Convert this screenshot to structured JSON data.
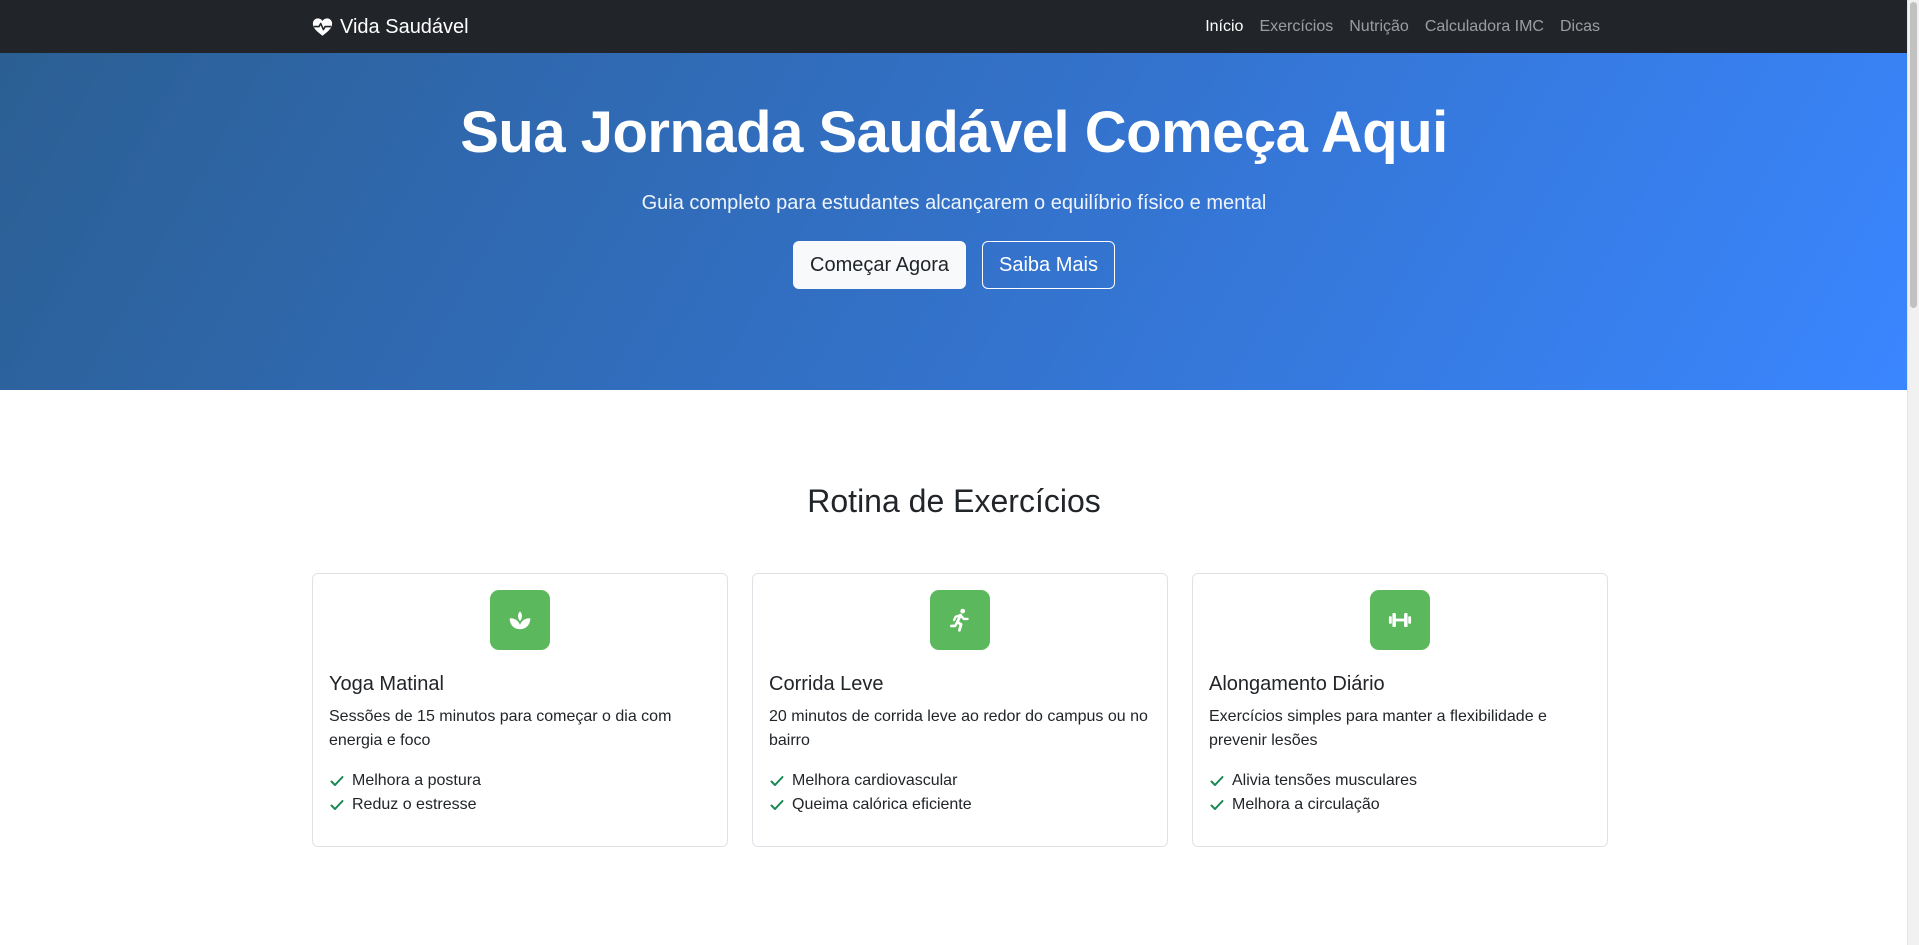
{
  "colors": {
    "navbar_bg": "#212529",
    "hero_gradient_start": "#2b5f93",
    "hero_gradient_end": "#3a86ff",
    "icon_bg": "#5cb85c",
    "check_color": "#198754"
  },
  "navbar": {
    "brand": "Vida Saudável",
    "brand_icon": "heart-pulse-icon",
    "links": [
      "Início",
      "Exercícios",
      "Nutrição",
      "Calculadora IMC",
      "Dicas"
    ],
    "active_link": "Início"
  },
  "hero": {
    "title": "Sua Jornada Saudável Começa Aqui",
    "subtitle": "Guia completo para estudantes alcançarem o equilíbrio físico e mental",
    "primary_button": "Começar Agora",
    "secondary_button": "Saiba Mais"
  },
  "exercises": {
    "title": "Rotina de Exercícios",
    "cards": [
      {
        "icon": "lotus-icon",
        "title": "Yoga Matinal",
        "text": "Sessões de 15 minutos para começar o dia com energia e foco",
        "benefits": [
          "Melhora a postura",
          "Reduz o estresse"
        ]
      },
      {
        "icon": "running-person-icon",
        "title": "Corrida Leve",
        "text": "20 minutos de corrida leve ao redor do campus ou no bairro",
        "benefits": [
          "Melhora cardiovascular",
          "Queima calórica eficiente"
        ]
      },
      {
        "icon": "dumbbell-icon",
        "title": "Alongamento Diário",
        "text": "Exercícios simples para manter a flexibilidade e prevenir lesões",
        "benefits": [
          "Alivia tensões musculares",
          "Melhora a circulação"
        ]
      }
    ]
  }
}
